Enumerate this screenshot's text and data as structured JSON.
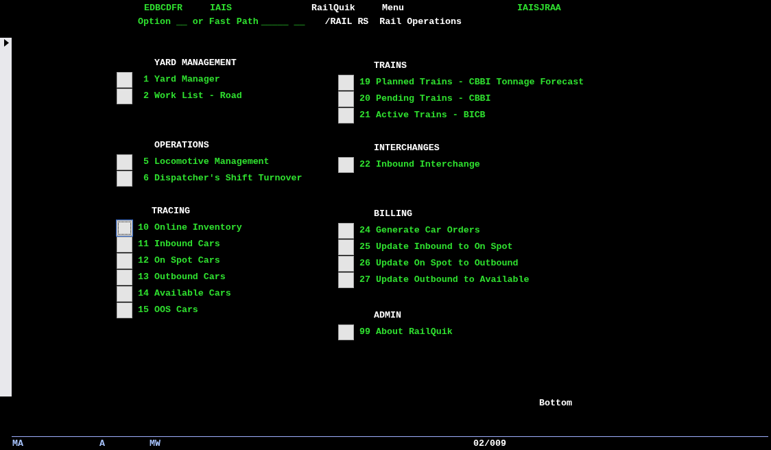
{
  "header": {
    "screen_id": "EDBCDFR",
    "company": "IAIS",
    "app_name": "RailQuik",
    "screen_type": "Menu",
    "user_id": "IAISJRAA",
    "option_label": "Option",
    "option_value": "__",
    "or_label": "or Fast Path",
    "fast_path_value": "_____",
    "fast_path_value_2": "__",
    "path": "/RAIL RS",
    "title": "Rail Operations"
  },
  "columns": [
    {
      "sections": [
        {
          "heading": "YARD MANAGEMENT",
          "items": [
            {
              "number": "1",
              "label": "Yard Manager",
              "focused": false
            },
            {
              "number": "2",
              "label": "Work List - Road",
              "focused": false
            }
          ]
        },
        {
          "heading": "OPERATIONS",
          "items": [
            {
              "number": "5",
              "label": "Locomotive Management",
              "focused": false
            },
            {
              "number": "6",
              "label": "Dispatcher's Shift Turnover",
              "focused": false
            }
          ]
        },
        {
          "heading": "TRACING",
          "items": [
            {
              "number": "10",
              "label": "Online Inventory",
              "focused": true
            },
            {
              "number": "11",
              "label": "Inbound Cars",
              "focused": false
            },
            {
              "number": "12",
              "label": "On Spot Cars",
              "focused": false
            },
            {
              "number": "13",
              "label": "Outbound Cars",
              "focused": false
            },
            {
              "number": "14",
              "label": "Available Cars",
              "focused": false
            },
            {
              "number": "15",
              "label": "OOS Cars",
              "focused": false
            }
          ]
        }
      ]
    },
    {
      "sections": [
        {
          "heading": "TRAINS",
          "items": [
            {
              "number": "19",
              "label": "Planned Trains - CBBI Tonnage Forecast",
              "focused": false
            },
            {
              "number": "20",
              "label": "Pending Trains - CBBI",
              "focused": false
            },
            {
              "number": "21",
              "label": "Active Trains - BICB",
              "focused": false
            }
          ]
        },
        {
          "heading": "INTERCHANGES",
          "items": [
            {
              "number": "22",
              "label": "Inbound Interchange",
              "focused": false
            }
          ]
        },
        {
          "heading": "BILLING",
          "items": [
            {
              "number": "24",
              "label": "Generate Car Orders",
              "focused": false
            },
            {
              "number": "25",
              "label": "Update Inbound to On Spot",
              "focused": false
            },
            {
              "number": "26",
              "label": "Update On Spot to Outbound",
              "focused": false
            },
            {
              "number": "27",
              "label": "Update Outbound to Available",
              "focused": false
            }
          ]
        },
        {
          "heading": "ADMIN",
          "items": [
            {
              "number": "99",
              "label": "About RailQuik",
              "focused": false
            }
          ]
        }
      ]
    }
  ],
  "more": "Bottom",
  "status_bar": {
    "field_1": "MA",
    "field_2": "A",
    "field_3": "MW",
    "position": "02/009"
  }
}
